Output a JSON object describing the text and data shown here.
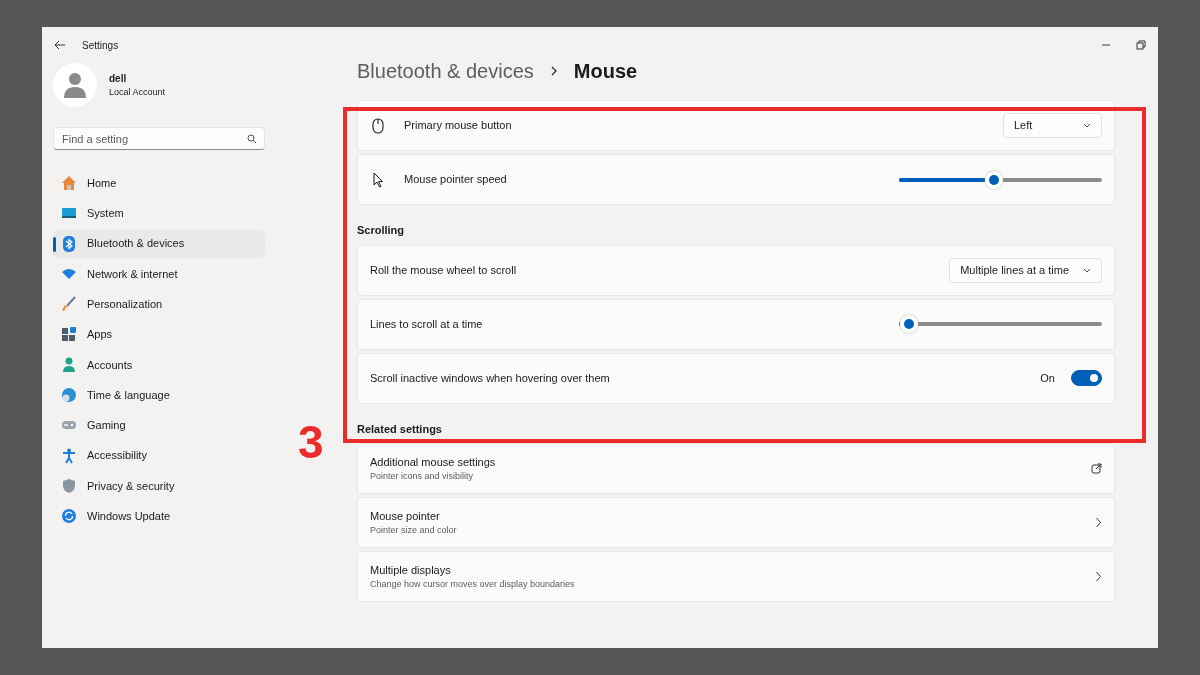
{
  "window": {
    "title": "Settings"
  },
  "account": {
    "name": "dell",
    "type": "Local Account"
  },
  "search": {
    "placeholder": "Find a setting"
  },
  "sidebar": {
    "items": [
      {
        "label": "Home",
        "selected": false
      },
      {
        "label": "System",
        "selected": false
      },
      {
        "label": "Bluetooth & devices",
        "selected": true
      },
      {
        "label": "Network & internet",
        "selected": false
      },
      {
        "label": "Personalization",
        "selected": false
      },
      {
        "label": "Apps",
        "selected": false
      },
      {
        "label": "Accounts",
        "selected": false
      },
      {
        "label": "Time & language",
        "selected": false
      },
      {
        "label": "Gaming",
        "selected": false
      },
      {
        "label": "Accessibility",
        "selected": false
      },
      {
        "label": "Privacy & security",
        "selected": false
      },
      {
        "label": "Windows Update",
        "selected": false
      }
    ]
  },
  "breadcrumb": {
    "parent": "Bluetooth & devices",
    "current": "Mouse"
  },
  "sections": [
    {
      "rows": [
        {
          "kind": "dropdown",
          "label": "Primary mouse button",
          "value": "Left"
        },
        {
          "kind": "slider",
          "label": "Mouse pointer speed",
          "level": 0.47
        }
      ]
    },
    {
      "heading": "Scrolling",
      "rows": [
        {
          "kind": "dropdown",
          "label": "Roll the mouse wheel to scroll",
          "value": "Multiple lines at a time"
        },
        {
          "kind": "slider",
          "label": "Lines to scroll at a time",
          "level": 0.05
        },
        {
          "kind": "toggle",
          "label": "Scroll inactive windows when hovering over them",
          "state_text": "On",
          "on": true
        }
      ]
    },
    {
      "heading": "Related settings",
      "rows": [
        {
          "kind": "external",
          "label": "Additional mouse settings",
          "description": "Pointer icons and visibility"
        },
        {
          "kind": "link",
          "label": "Mouse pointer",
          "description": "Pointer size and color"
        },
        {
          "kind": "link",
          "label": "Multiple displays",
          "description": "Change how cursor moves over display boundaries"
        }
      ]
    }
  ],
  "annotation": {
    "label": "3"
  }
}
